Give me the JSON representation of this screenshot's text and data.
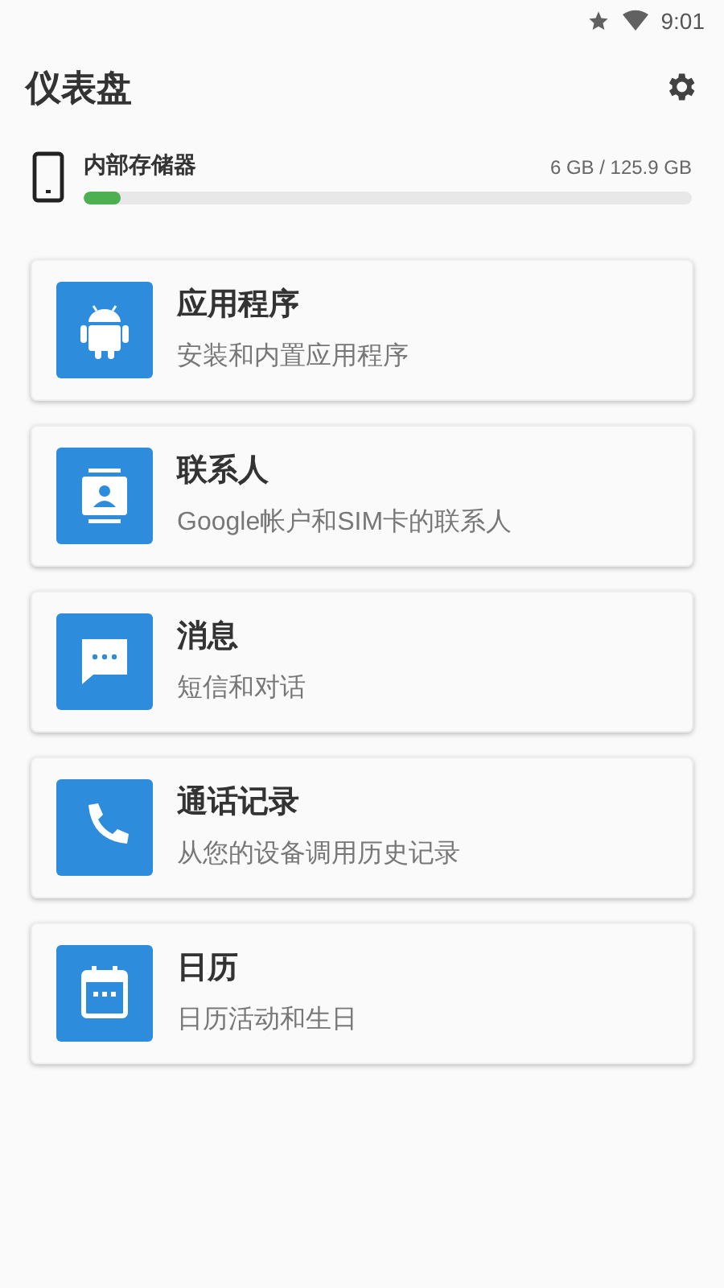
{
  "status_bar": {
    "time": "9:01"
  },
  "header": {
    "title": "仪表盘"
  },
  "storage": {
    "label": "内部存储器",
    "reading": "6 GB / 125.9 GB",
    "level": 0.06
  },
  "items": [
    {
      "kind": "apps",
      "title": "应用程序",
      "subtitle": "安装和内置应用程序"
    },
    {
      "kind": "contacts",
      "title": "联系人",
      "subtitle": "Google帐户和SIM卡的联系人"
    },
    {
      "kind": "messages",
      "title": "消息",
      "subtitle": "短信和对话"
    },
    {
      "kind": "calls",
      "title": "通话记录",
      "subtitle": "从您的设备调用历史记录"
    },
    {
      "kind": "calendar",
      "title": "日历",
      "subtitle": "日历活动和生日"
    }
  ]
}
